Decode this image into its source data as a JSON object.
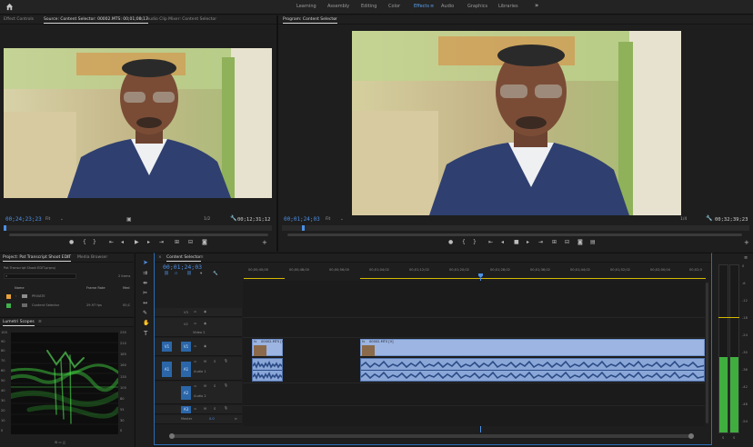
{
  "app": {
    "workspaces": [
      "Learning",
      "Assembly",
      "Editing",
      "Color",
      "Effects",
      "Audio",
      "Graphics",
      "Libraries"
    ],
    "active_workspace": "Effects",
    "more_label": "»"
  },
  "source_panel": {
    "tabs": [
      "Effect Controls",
      "Source: Content Selector: 00002.MTS: 00;01;00;13",
      "Audio Clip Mixer: Content Selector"
    ],
    "timecode": "00;24;23;23",
    "fit": "Fit",
    "resolution": "1/2",
    "duration": "00;12;31;12"
  },
  "program_panel": {
    "title": "Program: Content Selector",
    "timecode": "00;01;24;03",
    "fit": "Fit",
    "resolution": "1/4",
    "duration": "00;32;39;23"
  },
  "project_panel": {
    "tabs": [
      "Project: Pat Transcript Shoot EDIT",
      "Media Browser"
    ],
    "file": "Pat Transcript Shoot EDIT.prproj",
    "item_count": "2 items",
    "columns": [
      "Name",
      "Frame Rate",
      "Med"
    ],
    "items": [
      {
        "name": "PRIVATE",
        "fps": "",
        "med": "",
        "color": "#e8a13a"
      },
      {
        "name": "Content Selector",
        "fps": "29.97 fps",
        "med": "00;C",
        "color": "#3fb24c"
      }
    ]
  },
  "lumetri": {
    "title": "Lumetri Scopes",
    "scale_left": [
      "100",
      "90",
      "80",
      "70",
      "60",
      "50",
      "40",
      "30",
      "20",
      "10",
      "0"
    ],
    "scale_right": [
      "235",
      "210",
      "185",
      "160",
      "130",
      "105",
      "80",
      "55",
      "30",
      "0"
    ]
  },
  "timeline": {
    "tab": "Content Selector",
    "timecode": "00;01;24;03",
    "ruler": [
      "00;00;40;00",
      "00;00;48;00",
      "00;00;56;00",
      "00;01;04;02",
      "00;01;12;02",
      "00;01;20;02",
      "00;01;28;02",
      "00;01;36;02",
      "00;01;44;02",
      "00;01;52;02",
      "00;02;00;04",
      "00;02;0"
    ],
    "video_tracks": [
      {
        "id": "V3",
        "label": ""
      },
      {
        "id": "V2",
        "label": "Video 2"
      },
      {
        "id": "V1",
        "label": ""
      }
    ],
    "audio_tracks": [
      {
        "id": "A1",
        "label": "Audio 1"
      },
      {
        "id": "A2",
        "label": "Audio 2"
      },
      {
        "id": "A3",
        "label": ""
      }
    ],
    "master": {
      "label": "Master",
      "value": "0.0"
    },
    "clip_name_1": "00002.MTS [V]",
    "clip_name_2": "00002.MTS [V]",
    "track_toggle": {
      "m": "M",
      "s": "S"
    }
  },
  "audio_meter": {
    "scale": [
      "0",
      "-6",
      "-12",
      "-18",
      "-24",
      "-30",
      "-36",
      "-42",
      "-48",
      "-54"
    ],
    "footer": [
      "S",
      "S"
    ],
    "level": 0.45
  },
  "tools": [
    "selection",
    "track-select",
    "ripple",
    "razor",
    "slip",
    "pen",
    "hand",
    "type"
  ]
}
